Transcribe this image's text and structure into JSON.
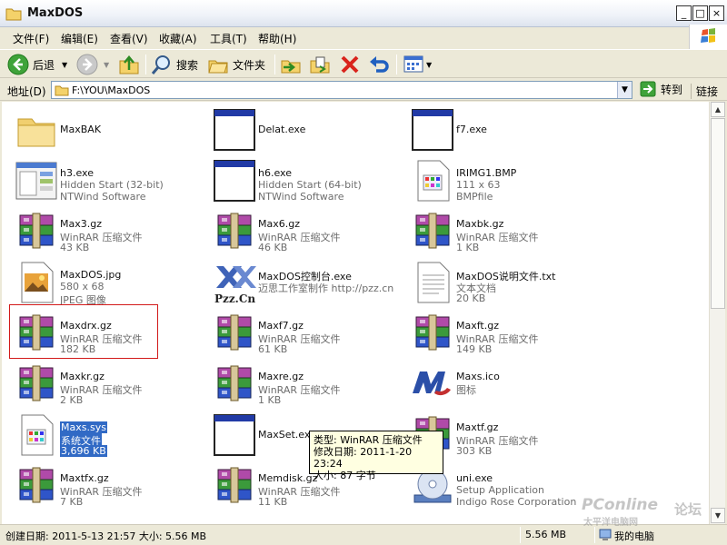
{
  "window": {
    "title": "MaxDOS"
  },
  "menu": [
    "文件(F)",
    "编辑(E)",
    "查看(V)",
    "收藏(A)",
    "工具(T)",
    "帮助(H)"
  ],
  "toolbar": {
    "back": "后退",
    "search": "搜索",
    "folders": "文件夹"
  },
  "address": {
    "label": "地址(D)",
    "path": "F:\\YOU\\MaxDOS",
    "go": "转到",
    "links": "链接"
  },
  "files": [
    {
      "name": "MaxBAK",
      "line2": "",
      "line3": "",
      "icon": "folder-icon"
    },
    {
      "name": "Delat.exe",
      "line2": "",
      "line3": "",
      "icon": "window-exe-icon"
    },
    {
      "name": "f7.exe",
      "line2": "",
      "line3": "",
      "icon": "window-exe-icon"
    },
    {
      "name": "h3.exe",
      "line2": "Hidden Start (32-bit)",
      "line3": "NTWind Software",
      "icon": "app-exe-icon"
    },
    {
      "name": "h6.exe",
      "line2": "Hidden Start (64-bit)",
      "line3": "NTWind Software",
      "icon": "window-exe-icon"
    },
    {
      "name": "IRIMG1.BMP",
      "line2": "111 x 63",
      "line3": "BMPfile",
      "icon": "bmp-file-icon"
    },
    {
      "name": "Max3.gz",
      "line2": "WinRAR 压缩文件",
      "line3": "43 KB",
      "icon": "winrar-archive-icon"
    },
    {
      "name": "Max6.gz",
      "line2": "WinRAR 压缩文件",
      "line3": "46 KB",
      "icon": "winrar-archive-icon"
    },
    {
      "name": "Maxbk.gz",
      "line2": "WinRAR 压缩文件",
      "line3": "1 KB",
      "icon": "winrar-archive-icon"
    },
    {
      "name": "MaxDOS.jpg",
      "line2": "580 x 68",
      "line3": "JPEG 图像",
      "icon": "jpeg-image-icon"
    },
    {
      "name": "MaxDOS控制台.exe",
      "line2": "迈思工作室制作 http://pzz.cn",
      "line3": "",
      "icon": "pzz-logo-icon"
    },
    {
      "name": "MaxDOS说明文件.txt",
      "line2": "文本文档",
      "line3": "20 KB",
      "icon": "text-document-icon"
    },
    {
      "name": "Maxdrx.gz",
      "line2": "WinRAR 压缩文件",
      "line3": "182 KB",
      "icon": "winrar-archive-icon"
    },
    {
      "name": "Maxf7.gz",
      "line2": "WinRAR 压缩文件",
      "line3": "61 KB",
      "icon": "winrar-archive-icon"
    },
    {
      "name": "Maxft.gz",
      "line2": "WinRAR 压缩文件",
      "line3": "149 KB",
      "icon": "winrar-archive-icon"
    },
    {
      "name": "Maxkr.gz",
      "line2": "WinRAR 压缩文件",
      "line3": "2 KB",
      "icon": "winrar-archive-icon"
    },
    {
      "name": "Maxre.gz",
      "line2": "WinRAR 压缩文件",
      "line3": "1 KB",
      "icon": "winrar-archive-icon"
    },
    {
      "name": "Maxs.ico",
      "line2": "图标",
      "line3": "",
      "icon": "maxs-ico-icon"
    },
    {
      "name": "Maxs.sys",
      "line2": "系统文件",
      "line3": "3,696 KB",
      "icon": "system-file-icon",
      "selected": true
    },
    {
      "name": "MaxSet.exe",
      "line2": "",
      "line3": "",
      "icon": "window-exe-icon"
    },
    {
      "name": "Maxtf.gz",
      "line2": "WinRAR 压缩文件",
      "line3": "303 KB",
      "icon": "winrar-archive-icon"
    },
    {
      "name": "Maxtfx.gz",
      "line2": "WinRAR 压缩文件",
      "line3": "7 KB",
      "icon": "winrar-archive-icon"
    },
    {
      "name": "Memdisk.gz",
      "line2": "WinRAR 压缩文件",
      "line3": "11 KB",
      "icon": "winrar-archive-icon"
    },
    {
      "name": "uni.exe",
      "line2": "Setup Application",
      "line3": "Indigo Rose Corporation",
      "icon": "setup-cd-icon"
    }
  ],
  "tooltip": {
    "line1": "类型: WinRAR 压缩文件",
    "line2": "修改日期: 2011-1-20 23:24",
    "line3": "大小: 87 字节"
  },
  "status": {
    "left": "创建日期: 2011-5-13 21:57 大小: 5.56 MB",
    "size": "5.56 MB",
    "location": "我的电脑"
  },
  "watermark": {
    "brand": "PConline",
    "sub": "太平洋电脑网",
    "forum": "论坛"
  }
}
